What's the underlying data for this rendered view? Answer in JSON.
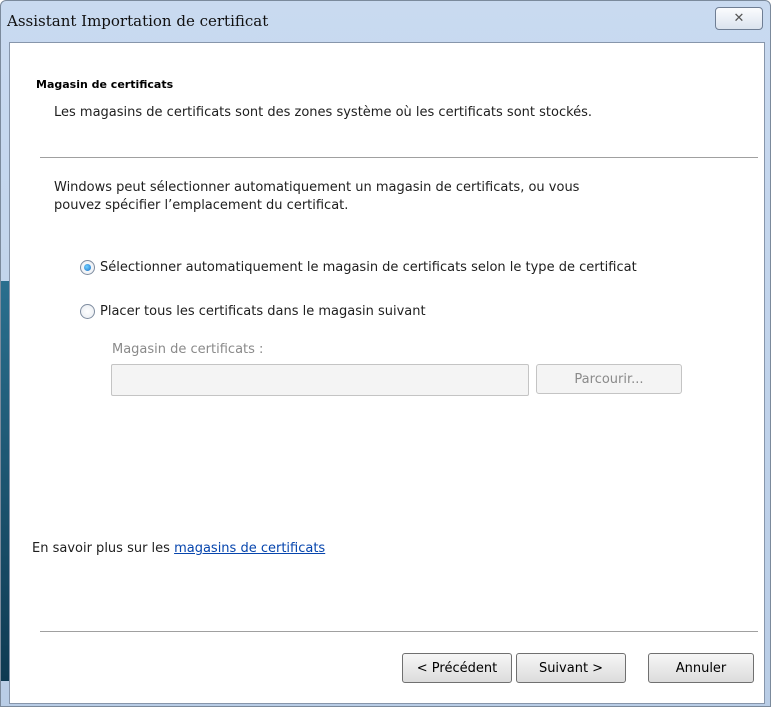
{
  "window": {
    "title": "Assistant Importation de certificat",
    "close_glyph": "✕"
  },
  "header": {
    "title": "Magasin de certificats",
    "description": "Les magasins de certificats sont des zones système où les certificats sont stockés."
  },
  "body": {
    "intro_line1": "Windows peut sélectionner automatiquement un magasin de certificats, ou vous",
    "intro_line2": "pouvez spécifier l’emplacement du certificat.",
    "option_auto": "Sélectionner automatiquement le magasin de certificats selon le type de certificat",
    "option_manual": "Placer tous les certificats dans le magasin suivant",
    "selected_option": "auto",
    "store_label": "Magasin de certificats :",
    "store_value": "",
    "browse_label": "Parcourir..."
  },
  "learn_more": {
    "prefix": "En savoir plus sur les ",
    "link": "magasins de certificats"
  },
  "footer": {
    "back_label": "< Précédent",
    "next_label": "Suivant >",
    "cancel_label": "Annuler"
  }
}
